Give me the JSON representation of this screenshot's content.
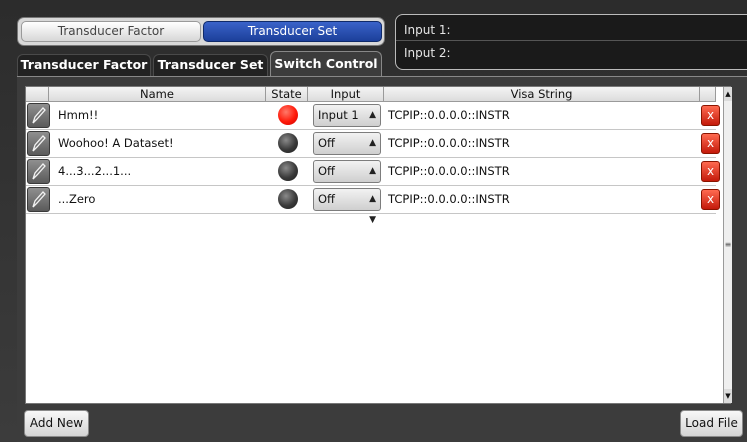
{
  "mode_toggle": {
    "left_label": "Transducer Factor",
    "right_label": "Transducer Set"
  },
  "input_panel": {
    "input1_label": "Input 1:",
    "input2_label": "Input 2:"
  },
  "tabs": [
    {
      "label": "Transducer Factor"
    },
    {
      "label": "Transducer Set"
    },
    {
      "label": "Switch Control"
    }
  ],
  "table": {
    "columns": [
      "Name",
      "State",
      "Input",
      "Visa String"
    ],
    "rows": [
      {
        "name": "Hmm!!",
        "state": "on",
        "input": "Input 1",
        "visa": "TCPIP::0.0.0.0::INSTR"
      },
      {
        "name": "Woohoo! A Dataset!",
        "state": "off",
        "input": "Off",
        "visa": "TCPIP::0.0.0.0::INSTR"
      },
      {
        "name": "4...3...2...1...",
        "state": "off",
        "input": "Off",
        "visa": "TCPIP::0.0.0.0::INSTR"
      },
      {
        "name": "...Zero",
        "state": "off",
        "input": "Off",
        "visa": "TCPIP::0.0.0.0::INSTR"
      }
    ]
  },
  "buttons": {
    "add_new": "Add New",
    "load_file": "Load File",
    "delete_glyph": "x"
  },
  "colors": {
    "active_mode": "#2a4fb3",
    "led_on": "#ff1a0a",
    "led_off": "#3a3a3a",
    "delete": "#d9240f"
  },
  "icons": [
    "pencil-icon",
    "delete-icon",
    "select-arrows-icon",
    "scroll-up-icon",
    "scroll-down-icon"
  ]
}
